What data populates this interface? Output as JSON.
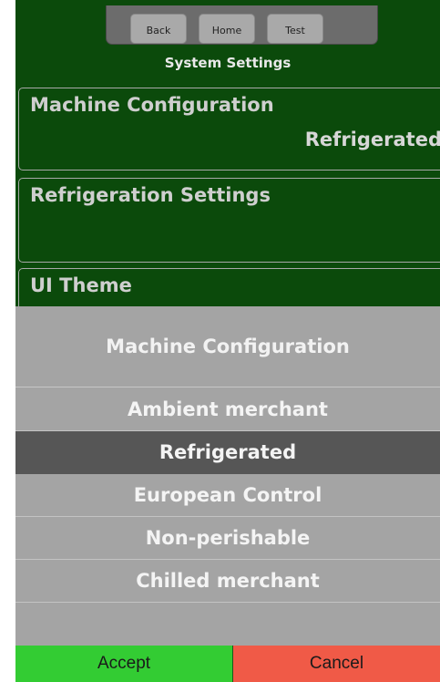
{
  "nav": {
    "back_label": "Back",
    "home_label": "Home",
    "test_label": "Test"
  },
  "header": {
    "title": "System Settings"
  },
  "settings": [
    {
      "label": "Machine Configuration",
      "value": "Refrigerated"
    },
    {
      "label": "Refrigeration Settings",
      "value": ""
    },
    {
      "label": "UI Theme",
      "value": ""
    }
  ],
  "picker": {
    "title": "Machine Configuration",
    "options": [
      "Ambient merchant",
      "Refrigerated",
      "European Control",
      "Non-perishable",
      "Chilled merchant"
    ],
    "selected_index": 1
  },
  "footer": {
    "accept_label": "Accept",
    "cancel_label": "Cancel"
  },
  "colors": {
    "screen_bg": "#0b4a0b",
    "accept": "#33cc33",
    "cancel": "#f05a47",
    "selected_option": "#565656"
  }
}
